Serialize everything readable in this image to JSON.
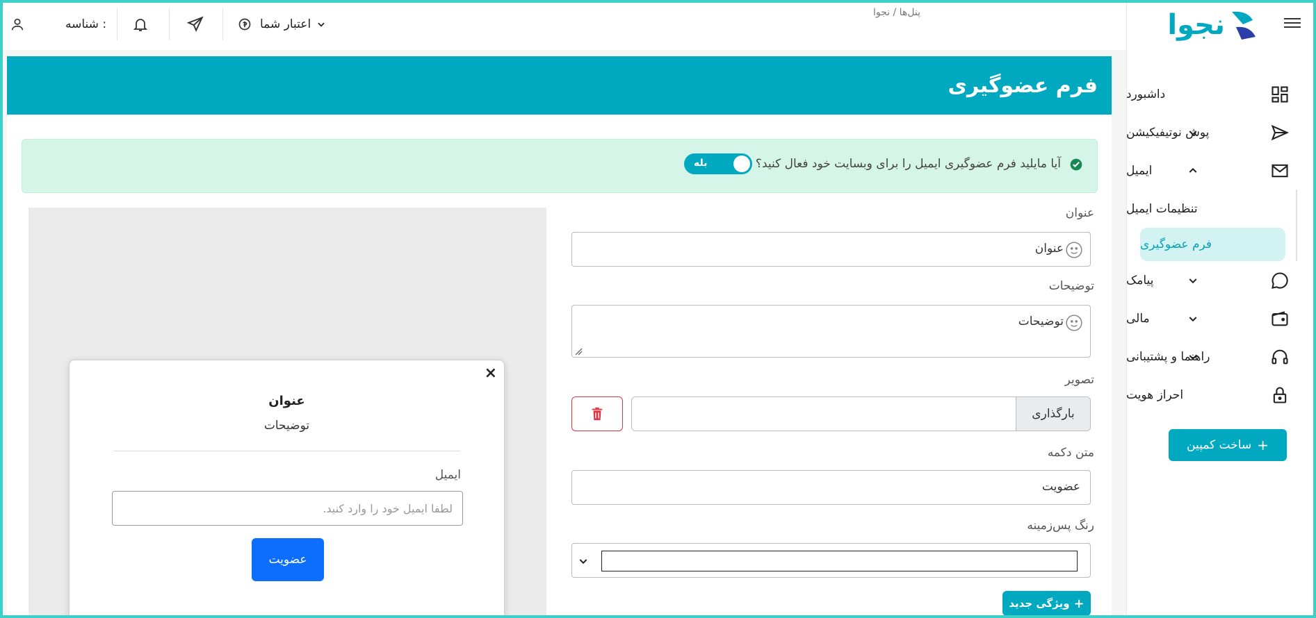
{
  "app": {
    "logo_text": "نجوا"
  },
  "breadcrumb": "پنل‌ها / نجوا",
  "topbar": {
    "user_label": "شناسه :",
    "credit_label": "اعتبار شما"
  },
  "sidebar": {
    "items": [
      {
        "label": "داشبورد",
        "icon": "dashboard-icon"
      },
      {
        "label": "پوش نوتیفیکیشن",
        "icon": "send-icon"
      },
      {
        "label": "ایمیل",
        "icon": "mail-icon"
      },
      {
        "label": "پیامک",
        "icon": "chat-icon"
      },
      {
        "label": "مالی",
        "icon": "wallet-icon"
      },
      {
        "label": "راهنما و پشتیبانی",
        "icon": "headset-icon"
      },
      {
        "label": "احراز هویت",
        "icon": "lock-icon"
      }
    ],
    "email_sub": [
      {
        "label": "تنظیمات ایمیل"
      },
      {
        "label": "فرم عضوگیری",
        "active": true
      }
    ],
    "create_button": "ساخت کمپین"
  },
  "page": {
    "title": "فرم عضوگیری",
    "alert_text": "آیا مایلید فرم عضوگیری ایمیل را برای وبسایت خود فعال کنید؟",
    "toggle_label": "بله"
  },
  "form": {
    "title_label": "عنوان",
    "title_value": "عنوان",
    "desc_label": "توضیحات",
    "desc_value": "توضیحات",
    "image_label": "تصویر",
    "upload_label": "بارگذاری",
    "button_text_label": "متن دکمه",
    "button_text_value": "عضویت",
    "bg_color_label": "رنگ پس‌زمینه",
    "bg_color_value": "#ffffff",
    "new_feature_button": "ویژگی جدید"
  },
  "preview": {
    "title": "عنوان",
    "description": "توضیحات",
    "email_label": "ایمیل",
    "email_placeholder": "لطفا ایمیل خود را وارد کنید.",
    "submit_label": "عضویت",
    "close_glyph": "×"
  },
  "colors": {
    "accent": "#00a9bf",
    "active_bg": "#d3f3f3",
    "alert_bg": "#d5f5e9",
    "danger": "#dc3545",
    "primary": "#0d6efd"
  }
}
